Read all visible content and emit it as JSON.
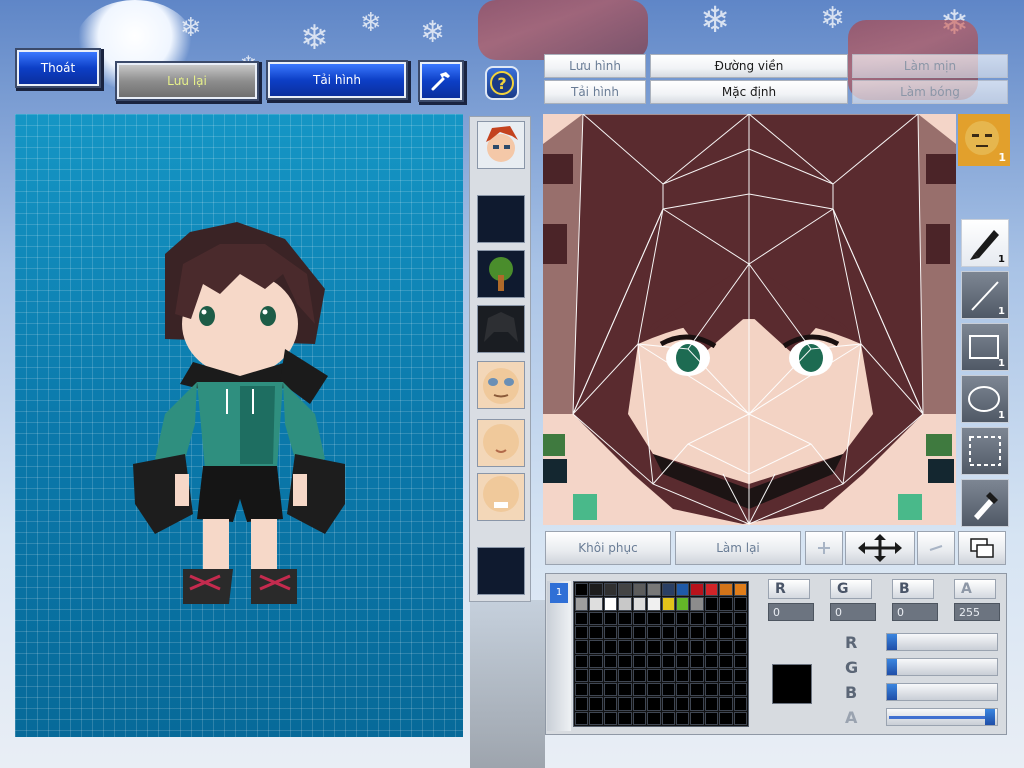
{
  "top_left_buttons": {
    "exit_label": "Thoát",
    "save_label": "Lưu lại",
    "load_label": "Tải hình"
  },
  "editor_tabs": {
    "save_image": "Lưu hình",
    "outline": "Đường viền",
    "smooth": "Làm mịn",
    "load_image": "Tải hình",
    "default": "Mặc định",
    "shade": "Làm bóng"
  },
  "tools": {
    "avatar_count": "1",
    "pen_count": "1",
    "line_count": "1",
    "rect_count": "1",
    "ellipse_count": "1"
  },
  "actions": {
    "restore_label": "Khôi phục",
    "redo_label": "Làm lại"
  },
  "palette": {
    "colors": [
      "#000000",
      "#1c1c1c",
      "#303030",
      "#444444",
      "#5c5c5c",
      "#787878",
      "#2a3f64",
      "#1f5aa8",
      "#b8121b",
      "#d02428",
      "#d2741a",
      "#e07d1a",
      "#9e9e9e",
      "#dedede",
      "#ffffff",
      "#c8c8c8",
      "#dcdcdc",
      "#f0f0f0",
      "#e2c21a",
      "#64b628",
      "#8c8c8c"
    ],
    "selected_color": "#000000"
  },
  "color_channels": {
    "r_label": "R",
    "g_label": "G",
    "b_label": "B",
    "a_label": "A",
    "r_value": "0",
    "g_value": "0",
    "b_value": "0",
    "a_value": "255"
  },
  "sliders": {
    "r_level": 0,
    "g_level": 0,
    "b_level": 0,
    "a_level": 1
  }
}
